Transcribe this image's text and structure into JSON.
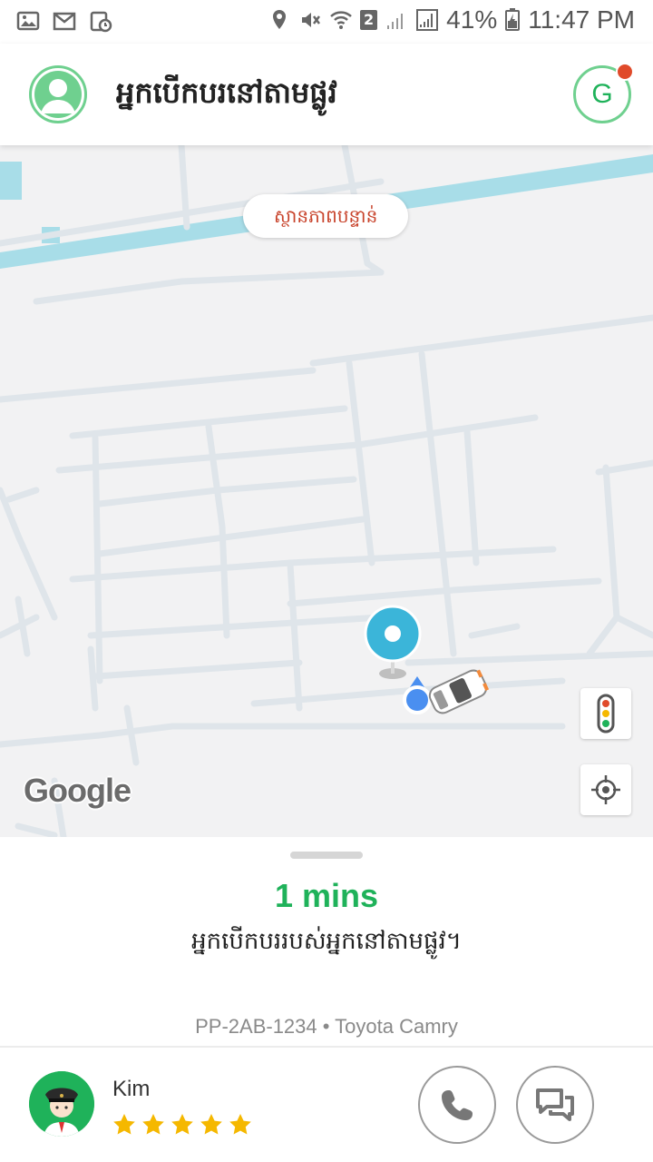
{
  "status_bar": {
    "wifi_badge": "2",
    "battery_percent": "41%",
    "time": "11:47 PM",
    "icons": [
      "image-icon",
      "gmail-icon",
      "clipboard-clock-icon",
      "location-icon",
      "mute-icon",
      "wifi-icon",
      "signal-icon",
      "battery-charging-icon"
    ]
  },
  "header": {
    "title": "អ្នកបើកបរនៅតាមផ្លូវ",
    "profile_icon": "user-avatar-icon",
    "rewards_letter": "G",
    "notification_color": "#e04a2a"
  },
  "map": {
    "traffic_pill": "ស្ថានភាពបន្ទាន់",
    "attribution": "Google",
    "controls": [
      "traffic-light-icon",
      "my-location-icon"
    ]
  },
  "sheet": {
    "eta": "1 mins",
    "eta_message": "អ្នកបើកបររបស់អ្នកនៅតាមផ្លូវ។",
    "vehicle": "PP-2AB-1234 • Toyota Camry",
    "driver": {
      "name": "Kim",
      "rating": 5
    }
  },
  "colors": {
    "accent": "#1fb25a",
    "pin": "#3bb5d9",
    "water": "#a8dde8",
    "star": "#f5b800"
  }
}
